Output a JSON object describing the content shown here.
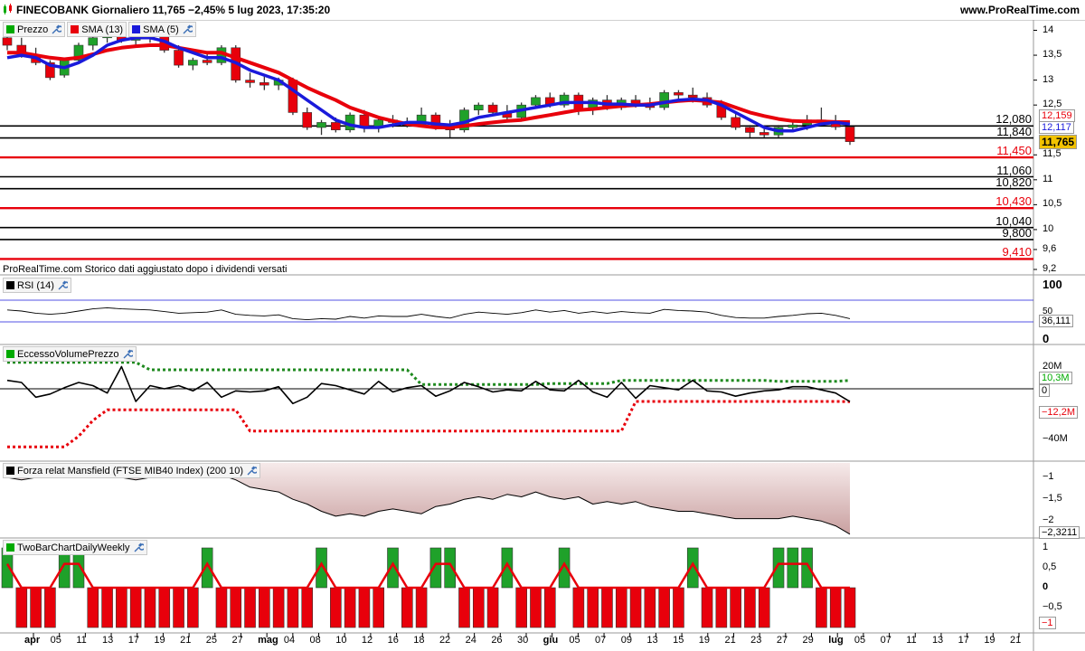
{
  "header": {
    "title": "FINECOBANK Giornaliero 11,765 −2,45% 5 lug 2023, 17:35:20",
    "site": "www.ProRealTime.com"
  },
  "price_panel": {
    "legend": [
      {
        "label": "Prezzo",
        "color": "#00aa00"
      },
      {
        "label": "SMA (13)",
        "color": "#e8000b"
      },
      {
        "label": "SMA (5)",
        "color": "#1a1adb"
      }
    ],
    "note": "ProRealTime.com  Storico dati aggiustato dopo i dividendi versati",
    "y_ticks": [
      "14",
      "13,5",
      "13",
      "12,5",
      "11,5",
      "11",
      "10,5",
      "10",
      "9,6",
      "9,2"
    ],
    "levels": [
      {
        "label": "12,080",
        "value": 12.08,
        "color": "#000000"
      },
      {
        "label": "11,840",
        "value": 11.84,
        "color": "#000000"
      },
      {
        "label": "11,450",
        "value": 11.45,
        "color": "#e8000b"
      },
      {
        "label": "11,060",
        "value": 11.06,
        "color": "#000000"
      },
      {
        "label": "10,820",
        "value": 10.82,
        "color": "#000000"
      },
      {
        "label": "10,430",
        "value": 10.43,
        "color": "#e8000b"
      },
      {
        "label": "10,040",
        "value": 10.04,
        "color": "#000000"
      },
      {
        "label": "9,800",
        "value": 9.8,
        "color": "#000000"
      },
      {
        "label": "9,410",
        "value": 9.41,
        "color": "#e8000b"
      }
    ],
    "tags": {
      "sma13": "12,159",
      "sma5": "12,117",
      "last": "11,765"
    }
  },
  "rsi_panel": {
    "legend": "RSI (14)",
    "y_ticks": [
      "100",
      "50",
      "0"
    ],
    "tag": "36,111"
  },
  "volume_panel": {
    "legend": "EccessoVolumePrezzo",
    "y_ticks": [
      "20M",
      "0",
      "−12,2M",
      "−40M"
    ],
    "tag_green": "10,3M",
    "tag_black": "0",
    "tag_red": "−12,2M"
  },
  "mansfield_panel": {
    "legend": "Forza relat Mansfield (FTSE MIB40 Index) (200 10)",
    "y_ticks": [
      "−1",
      "−1,5",
      "−2"
    ],
    "tag": "−2,3211"
  },
  "twobar_panel": {
    "legend": "TwoBarChartDailyWeekly",
    "y_ticks": [
      "1",
      "0,5",
      "0",
      "−0,5"
    ],
    "tag": "−1"
  },
  "x_axis": [
    "apr",
    "05",
    "11",
    "13",
    "17",
    "19",
    "21",
    "25",
    "27",
    "mag",
    "04",
    "08",
    "10",
    "12",
    "16",
    "18",
    "22",
    "24",
    "26",
    "30",
    "giu",
    "05",
    "07",
    "09",
    "13",
    "15",
    "19",
    "21",
    "23",
    "27",
    "29",
    "lug",
    "05",
    "07",
    "11",
    "13",
    "17",
    "19",
    "21"
  ],
  "chart_data": {
    "type": "candlestick",
    "title": "FINECOBANK Giornaliero",
    "ylim": [
      9.2,
      14.1
    ],
    "ohlc": [
      [
        13.85,
        13.95,
        13.6,
        13.7
      ],
      [
        13.7,
        13.85,
        13.45,
        13.5
      ],
      [
        13.5,
        13.65,
        13.3,
        13.35
      ],
      [
        13.35,
        13.4,
        13.0,
        13.05
      ],
      [
        13.1,
        13.45,
        13.05,
        13.4
      ],
      [
        13.4,
        13.75,
        13.35,
        13.7
      ],
      [
        13.7,
        13.9,
        13.6,
        13.85
      ],
      [
        13.85,
        14.0,
        13.75,
        13.9
      ],
      [
        13.9,
        14.05,
        13.75,
        13.8
      ],
      [
        13.8,
        13.95,
        13.7,
        13.85
      ],
      [
        13.85,
        14.0,
        13.75,
        13.9
      ],
      [
        13.9,
        13.95,
        13.55,
        13.6
      ],
      [
        13.6,
        13.7,
        13.25,
        13.3
      ],
      [
        13.3,
        13.45,
        13.2,
        13.4
      ],
      [
        13.4,
        13.55,
        13.3,
        13.35
      ],
      [
        13.35,
        13.7,
        13.3,
        13.65
      ],
      [
        13.65,
        13.7,
        12.95,
        13.0
      ],
      [
        13.0,
        13.15,
        12.85,
        12.95
      ],
      [
        12.95,
        13.1,
        12.8,
        12.9
      ],
      [
        12.9,
        13.05,
        12.8,
        13.0
      ],
      [
        13.0,
        13.05,
        12.3,
        12.35
      ],
      [
        12.35,
        12.45,
        12.0,
        12.05
      ],
      [
        12.05,
        12.2,
        11.9,
        12.15
      ],
      [
        12.15,
        12.25,
        11.95,
        12.0
      ],
      [
        12.0,
        12.35,
        11.95,
        12.3
      ],
      [
        12.3,
        12.4,
        11.95,
        12.05
      ],
      [
        12.05,
        12.25,
        11.95,
        12.2
      ],
      [
        12.2,
        12.3,
        12.05,
        12.15
      ],
      [
        12.15,
        12.25,
        12.05,
        12.1
      ],
      [
        12.1,
        12.45,
        12.05,
        12.3
      ],
      [
        12.3,
        12.35,
        12.0,
        12.05
      ],
      [
        12.05,
        12.2,
        11.85,
        12.0
      ],
      [
        12.0,
        12.45,
        11.95,
        12.4
      ],
      [
        12.4,
        12.55,
        12.3,
        12.5
      ],
      [
        12.5,
        12.55,
        12.3,
        12.35
      ],
      [
        12.35,
        12.5,
        12.2,
        12.25
      ],
      [
        12.25,
        12.55,
        12.2,
        12.5
      ],
      [
        12.5,
        12.7,
        12.45,
        12.65
      ],
      [
        12.65,
        12.75,
        12.45,
        12.5
      ],
      [
        12.5,
        12.75,
        12.45,
        12.7
      ],
      [
        12.7,
        12.75,
        12.3,
        12.4
      ],
      [
        12.4,
        12.65,
        12.3,
        12.6
      ],
      [
        12.6,
        12.7,
        12.4,
        12.45
      ],
      [
        12.45,
        12.65,
        12.4,
        12.6
      ],
      [
        12.6,
        12.7,
        12.45,
        12.5
      ],
      [
        12.5,
        12.65,
        12.4,
        12.45
      ],
      [
        12.45,
        12.8,
        12.4,
        12.75
      ],
      [
        12.75,
        12.8,
        12.6,
        12.7
      ],
      [
        12.7,
        12.85,
        12.55,
        12.65
      ],
      [
        12.65,
        12.75,
        12.45,
        12.5
      ],
      [
        12.5,
        12.6,
        12.2,
        12.25
      ],
      [
        12.25,
        12.35,
        12.0,
        12.05
      ],
      [
        12.05,
        12.1,
        11.85,
        11.95
      ],
      [
        11.95,
        12.05,
        11.85,
        11.9
      ],
      [
        11.9,
        12.1,
        11.85,
        12.05
      ],
      [
        12.05,
        12.2,
        11.95,
        12.1
      ],
      [
        12.1,
        12.3,
        12.0,
        12.2
      ],
      [
        12.2,
        12.45,
        12.1,
        12.15
      ],
      [
        12.15,
        12.3,
        12.0,
        12.06
      ],
      [
        12.06,
        12.06,
        11.7,
        11.765
      ]
    ],
    "sma13": [
      13.55,
      13.55,
      13.5,
      13.45,
      13.42,
      13.45,
      13.52,
      13.6,
      13.65,
      13.68,
      13.7,
      13.7,
      13.65,
      13.6,
      13.55,
      13.55,
      13.45,
      13.35,
      13.25,
      13.15,
      13.0,
      12.85,
      12.72,
      12.6,
      12.45,
      12.35,
      12.25,
      12.18,
      12.12,
      12.08,
      12.05,
      12.05,
      12.08,
      12.12,
      12.15,
      12.18,
      12.2,
      12.25,
      12.3,
      12.35,
      12.4,
      12.42,
      12.45,
      12.48,
      12.5,
      12.52,
      12.55,
      12.58,
      12.6,
      12.58,
      12.55,
      12.45,
      12.35,
      12.28,
      12.22,
      12.18,
      12.17,
      12.17,
      12.16,
      12.159
    ],
    "sma5": [
      13.45,
      13.5,
      13.45,
      13.3,
      13.25,
      13.35,
      13.5,
      13.7,
      13.8,
      13.85,
      13.85,
      13.78,
      13.65,
      13.55,
      13.45,
      13.45,
      13.35,
      13.2,
      13.1,
      13.0,
      12.8,
      12.6,
      12.4,
      12.2,
      12.1,
      12.05,
      12.05,
      12.1,
      12.15,
      12.15,
      12.12,
      12.1,
      12.15,
      12.25,
      12.3,
      12.35,
      12.4,
      12.45,
      12.5,
      12.55,
      12.55,
      12.55,
      12.52,
      12.52,
      12.5,
      12.5,
      12.55,
      12.6,
      12.62,
      12.6,
      12.5,
      12.35,
      12.2,
      12.05,
      11.98,
      11.98,
      12.05,
      12.12,
      12.15,
      12.117
    ],
    "rsi": [
      52,
      50,
      46,
      44,
      46,
      50,
      54,
      56,
      54,
      53,
      52,
      49,
      46,
      47,
      48,
      52,
      44,
      42,
      41,
      43,
      36,
      34,
      36,
      35,
      40,
      37,
      41,
      40,
      40,
      44,
      40,
      37,
      44,
      48,
      46,
      44,
      47,
      52,
      48,
      51,
      46,
      49,
      46,
      49,
      47,
      46,
      53,
      51,
      50,
      48,
      42,
      38,
      37,
      37,
      40,
      42,
      45,
      46,
      42,
      36
    ],
    "volume_excess": [
      8,
      6,
      -8,
      -5,
      1,
      6,
      3,
      -4,
      21,
      -12,
      3,
      0,
      3,
      -2,
      6,
      -8,
      -2,
      -3,
      -2,
      2,
      -14,
      -8,
      5,
      3,
      -1,
      -5,
      7,
      -3,
      1,
      3,
      -7,
      -2,
      6,
      2,
      -3,
      -1,
      -2,
      7,
      -1,
      -2,
      8,
      -3,
      -8,
      6,
      -9,
      3,
      1,
      -1,
      8,
      -2,
      -3,
      -7,
      -4,
      -2,
      -1,
      2,
      2,
      -1,
      -4,
      -12.2
    ],
    "volume_upper": [
      25,
      25,
      25,
      25,
      25,
      25,
      25,
      25,
      25,
      25,
      18,
      18,
      18,
      18,
      18,
      18,
      18,
      18,
      18,
      18,
      18,
      18,
      18,
      18,
      18,
      18,
      18,
      18,
      18,
      4,
      4,
      4,
      4,
      4,
      4,
      4,
      4,
      4,
      5,
      5,
      5,
      5,
      5,
      8,
      8,
      8,
      8,
      8,
      8,
      8,
      8,
      8,
      8,
      8,
      7,
      7,
      7,
      7,
      7,
      8
    ],
    "volume_lower": [
      -55,
      -55,
      -55,
      -55,
      -55,
      -45,
      -30,
      -20,
      -20,
      -20,
      -20,
      -20,
      -20,
      -20,
      -20,
      -20,
      -20,
      -40,
      -40,
      -40,
      -40,
      -40,
      -40,
      -40,
      -40,
      -40,
      -40,
      -40,
      -40,
      -40,
      -40,
      -40,
      -40,
      -40,
      -40,
      -40,
      -40,
      -40,
      -40,
      -40,
      -40,
      -40,
      -40,
      -40,
      -12,
      -12,
      -12,
      -12,
      -12,
      -12,
      -12,
      -12,
      -12,
      -12,
      -12,
      -12,
      -12,
      -12,
      -12,
      -12.2
    ],
    "mansfield": [
      -1.15,
      -1.2,
      -1.15,
      -1.1,
      -1.15,
      -1.05,
      -1.05,
      -1.0,
      -1.15,
      -1.2,
      -1.15,
      -1.1,
      -1.15,
      -1.1,
      -1.15,
      -1.1,
      -1.2,
      -1.35,
      -1.4,
      -1.45,
      -1.6,
      -1.7,
      -1.85,
      -1.95,
      -1.9,
      -1.95,
      -1.85,
      -1.8,
      -1.85,
      -1.9,
      -1.75,
      -1.7,
      -1.6,
      -1.55,
      -1.6,
      -1.5,
      -1.55,
      -1.45,
      -1.55,
      -1.6,
      -1.55,
      -1.7,
      -1.65,
      -1.7,
      -1.65,
      -1.75,
      -1.8,
      -1.85,
      -1.85,
      -1.9,
      -1.95,
      -2.0,
      -2.0,
      -2.0,
      -2.0,
      -1.95,
      -2.0,
      -2.05,
      -2.15,
      -2.3211
    ],
    "twobar": [
      1,
      -1,
      -1,
      -1,
      1,
      1,
      -1,
      -1,
      -1,
      -1,
      -1,
      -1,
      -1,
      -1,
      1,
      -1,
      -1,
      -1,
      -1,
      -1,
      -1,
      -1,
      1,
      -1,
      -1,
      -1,
      -1,
      1,
      -1,
      -1,
      1,
      1,
      -1,
      -1,
      -1,
      1,
      -1,
      -1,
      -1,
      1,
      -1,
      -1,
      -1,
      -1,
      -1,
      -1,
      -1,
      -1,
      1,
      -1,
      -1,
      -1,
      -1,
      -1,
      1,
      1,
      1,
      -1,
      -1,
      -1
    ]
  }
}
